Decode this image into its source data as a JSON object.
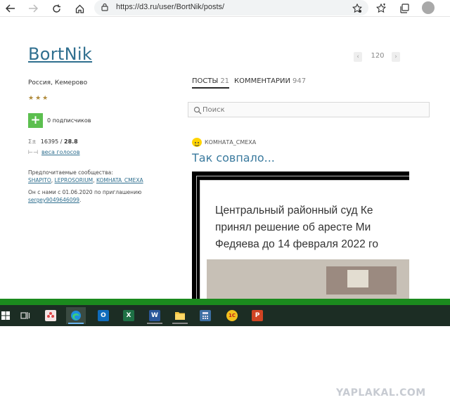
{
  "browser": {
    "url": "https://d3.ru/user/BortNik/posts/"
  },
  "profile": {
    "username": "BortNik",
    "location": "Россия, Кемерово",
    "stars": "★★★",
    "subscribers": "0 подписчиков",
    "rating_main": "16395",
    "rating_sep": " / ",
    "rating_bold": "28.8",
    "weights_link": "веса голосов",
    "preferred_label": "Предпочитаемые сообщества:",
    "communities": [
      "SHAPITO",
      "LEPROSORIUM",
      "KOMHATA_CMEXA"
    ],
    "joined_text": "Он с нами с 01.06.2020 по приглашению",
    "inviter": "sergey9049646099"
  },
  "pager": {
    "prev": "‹",
    "page": "120",
    "next": "›"
  },
  "tabs": [
    {
      "label": "ПОСТЫ",
      "count": "21",
      "active": true
    },
    {
      "label": "КОММЕНТАРИИ",
      "count": "947",
      "active": false
    }
  ],
  "search": {
    "placeholder": "Поиск"
  },
  "post": {
    "community": "КОМНАТА_СМЕХА",
    "title": "Так совпало...",
    "image_lines": [
      "Центральный районный суд Ке",
      "принял решение об аресте Ми",
      "Федяева до 14 февраля 2022 го"
    ]
  },
  "taskbar": {
    "apps": [
      {
        "name": "start",
        "icon": "windows-icon"
      },
      {
        "name": "task-view",
        "icon": "task-view-icon"
      },
      {
        "name": "app-pink",
        "icon": "flower-icon"
      },
      {
        "name": "edge",
        "icon": "edge-icon",
        "active": true
      },
      {
        "name": "outlook",
        "icon": "outlook-icon",
        "letter": "O"
      },
      {
        "name": "excel",
        "icon": "excel-icon",
        "letter": "X"
      },
      {
        "name": "word",
        "icon": "word-icon",
        "letter": "W"
      },
      {
        "name": "explorer",
        "icon": "folder-icon"
      },
      {
        "name": "calculator",
        "icon": "calculator-icon"
      },
      {
        "name": "1c",
        "icon": "1c-icon",
        "letter": "1С"
      },
      {
        "name": "powerpoint",
        "icon": "powerpoint-icon",
        "letter": "P"
      }
    ]
  },
  "watermark": "YAPLAKAL.COM",
  "colors": {
    "link": "#2f6f8f",
    "title": "#3a7a9e",
    "subscribe_green": "#5cbf4f",
    "band_green": "#1b8a1e",
    "taskbar": "#1c2d24"
  }
}
